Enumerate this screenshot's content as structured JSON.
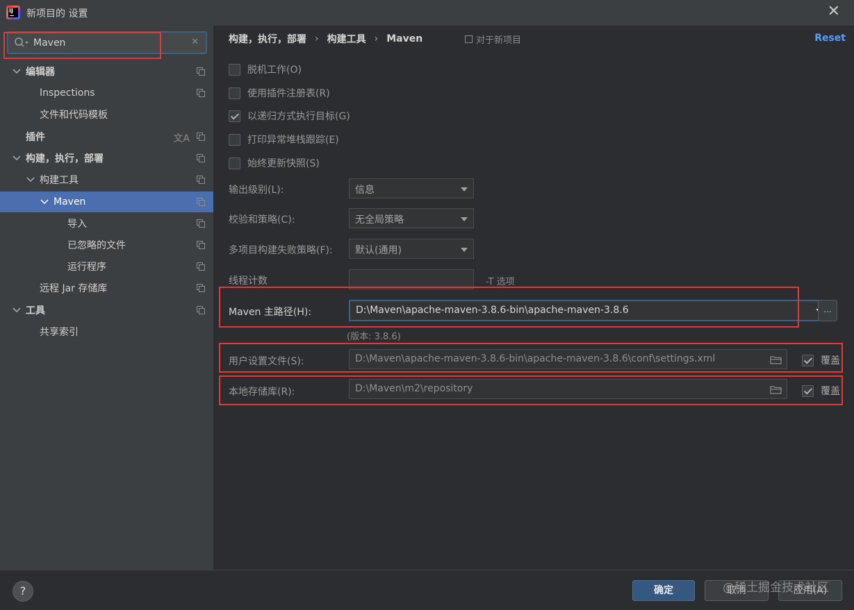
{
  "window": {
    "title": "新项目的 设置"
  },
  "search": {
    "value": "Maven"
  },
  "sidebar": {
    "items": [
      {
        "label": "编辑器"
      },
      {
        "label": "Inspections"
      },
      {
        "label": "文件和代码模板"
      },
      {
        "label": "插件"
      },
      {
        "label": "构建，执行，部署"
      },
      {
        "label": "构建工具"
      },
      {
        "label": "Maven"
      },
      {
        "label": "导入"
      },
      {
        "label": "已忽略的文件"
      },
      {
        "label": "运行程序"
      },
      {
        "label": "远程 Jar 存储库"
      },
      {
        "label": "工具"
      },
      {
        "label": "共享索引"
      }
    ]
  },
  "breadcrumb": {
    "part1": "构建，执行，部署",
    "part2": "构建工具",
    "part3": "Maven",
    "sep": "›"
  },
  "header": {
    "for_new_project": "对于新项目",
    "reset": "Reset"
  },
  "options": {
    "offline": {
      "label": "脱机工作(O)",
      "checked": false
    },
    "plugin_registry": {
      "label": "使用插件注册表(R)",
      "checked": false
    },
    "recursive": {
      "label": "以递归方式执行目标(G)",
      "checked": true
    },
    "print_stack": {
      "label": "打印异常堆栈跟踪(E)",
      "checked": false
    },
    "always_update": {
      "label": "始终更新快照(S)",
      "checked": false
    }
  },
  "fields": {
    "output_level": {
      "label": "输出级别(L):",
      "value": "信息"
    },
    "checksum_policy": {
      "label": "校验和策略(C):",
      "value": "无全局策略"
    },
    "multiproject_fail": {
      "label": "多项目构建失败策略(F):",
      "value": "默认(通用)"
    },
    "thread_count": {
      "label": "线程计数",
      "value": "",
      "hint": "-T 选项"
    },
    "maven_home": {
      "label": "Maven 主路径(H):",
      "value": "D:\\Maven\\apache-maven-3.8.6-bin\\apache-maven-3.8.6",
      "version": "(版本: 3.8.6)",
      "browse": "..."
    },
    "user_settings": {
      "label": "用户设置文件(S):",
      "value": "D:\\Maven\\apache-maven-3.8.6-bin\\apache-maven-3.8.6\\conf\\settings.xml",
      "override_label": "覆盖",
      "override": true
    },
    "local_repo": {
      "label": "本地存储库(R):",
      "value": "D:\\Maven\\m2\\repository",
      "override_label": "覆盖",
      "override": true
    }
  },
  "footer": {
    "help": "?",
    "ok": "确定",
    "cancel": "取消",
    "apply": "应用(A)",
    "watermark": "@稀土掘金技术社区"
  },
  "colors": {
    "accent": "#4b6eaf",
    "highlight_red": "#e53935",
    "link": "#589df6"
  }
}
